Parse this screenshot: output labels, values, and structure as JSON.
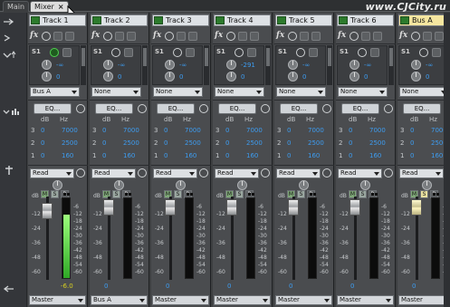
{
  "tabs": [
    {
      "label": "Main",
      "active": false
    },
    {
      "label": "Mixer",
      "active": true,
      "closable": true
    }
  ],
  "watermark": "www.CJCity.ru",
  "row_icons": [
    "output-arrow-icon",
    "play-icon",
    "fx-icon",
    "sends-icon",
    "eq-icon",
    "automation-icon",
    "output-left-arrow-icon"
  ],
  "channels": [
    {
      "name": "Track 1",
      "send_enabled": true,
      "send_level": "-∞",
      "send_pan": "0",
      "send_bus": "Bus A",
      "eq": {
        "label": "EQ...",
        "rows": [
          [
            "3",
            "0",
            "7000"
          ],
          [
            "2",
            "0",
            "2500"
          ],
          [
            "1",
            "0",
            "160"
          ]
        ]
      },
      "automation": "Read",
      "meter_active": true,
      "gain": "-6.0",
      "output": "Master",
      "bus": false
    },
    {
      "name": "Track 2",
      "send_enabled": false,
      "send_level": "-∞",
      "send_pan": "0",
      "send_bus": "None",
      "eq": {
        "label": "EQ...",
        "rows": [
          [
            "3",
            "0",
            "7000"
          ],
          [
            "2",
            "0",
            "2500"
          ],
          [
            "1",
            "0",
            "160"
          ]
        ]
      },
      "automation": "Read",
      "meter_active": false,
      "gain": "0",
      "output": "Bus A",
      "bus": false
    },
    {
      "name": "Track 3",
      "send_enabled": false,
      "send_level": "-∞",
      "send_pan": "0",
      "send_bus": "None",
      "eq": {
        "label": "EQ...",
        "rows": [
          [
            "3",
            "0",
            "7000"
          ],
          [
            "2",
            "0",
            "2500"
          ],
          [
            "1",
            "0",
            "160"
          ]
        ]
      },
      "automation": "Read",
      "meter_active": false,
      "gain": "0",
      "output": "Master",
      "bus": false
    },
    {
      "name": "Track 4",
      "send_enabled": false,
      "send_level": "-291",
      "send_pan": "0",
      "send_bus": "None",
      "eq": {
        "label": "EQ...",
        "rows": [
          [
            "3",
            "0",
            "7000"
          ],
          [
            "2",
            "0",
            "2500"
          ],
          [
            "1",
            "0",
            "160"
          ]
        ]
      },
      "automation": "Read",
      "meter_active": false,
      "gain": "0",
      "output": "Master",
      "bus": false
    },
    {
      "name": "Track 5",
      "send_enabled": false,
      "send_level": "-∞",
      "send_pan": "0",
      "send_bus": "None",
      "eq": {
        "label": "EQ...",
        "rows": [
          [
            "3",
            "0",
            "7000"
          ],
          [
            "2",
            "0",
            "2500"
          ],
          [
            "1",
            "0",
            "160"
          ]
        ]
      },
      "automation": "Read",
      "meter_active": false,
      "gain": "0",
      "output": "Master",
      "bus": false
    },
    {
      "name": "Track 6",
      "send_enabled": false,
      "send_level": "-∞",
      "send_pan": "0",
      "send_bus": "None",
      "eq": {
        "label": "EQ...",
        "rows": [
          [
            "3",
            "0",
            "7000"
          ],
          [
            "2",
            "0",
            "2500"
          ],
          [
            "1",
            "0",
            "160"
          ]
        ]
      },
      "automation": "Read",
      "meter_active": false,
      "gain": "0",
      "output": "Master",
      "bus": false
    },
    {
      "name": "Bus A",
      "send_enabled": false,
      "send_level": "-∞",
      "send_pan": "0",
      "send_bus": "None",
      "eq": {
        "label": "EQ...",
        "rows": [
          [
            "3",
            "0",
            "7000"
          ],
          [
            "2",
            "0",
            "2500"
          ],
          [
            "1",
            "0",
            "160"
          ]
        ]
      },
      "automation": "Read",
      "meter_active": false,
      "gain": "0",
      "output": "Master",
      "bus": true
    }
  ],
  "eq_headers": {
    "db": "dB",
    "hz": "Hz"
  },
  "meter_scale": [
    "dB",
    "-6",
    "-12",
    "-18",
    "-24",
    "-30",
    "-36",
    "-42",
    "-48",
    "-54",
    "-60"
  ],
  "msr": {
    "m": "M",
    "s": "S",
    "r": "R"
  },
  "colors": {
    "track_io_green": "#2c7a2c",
    "meter_green": "#2fa826",
    "value_blue": "#3d9cf0",
    "bus_name_yellow": "#f5e6a0"
  }
}
